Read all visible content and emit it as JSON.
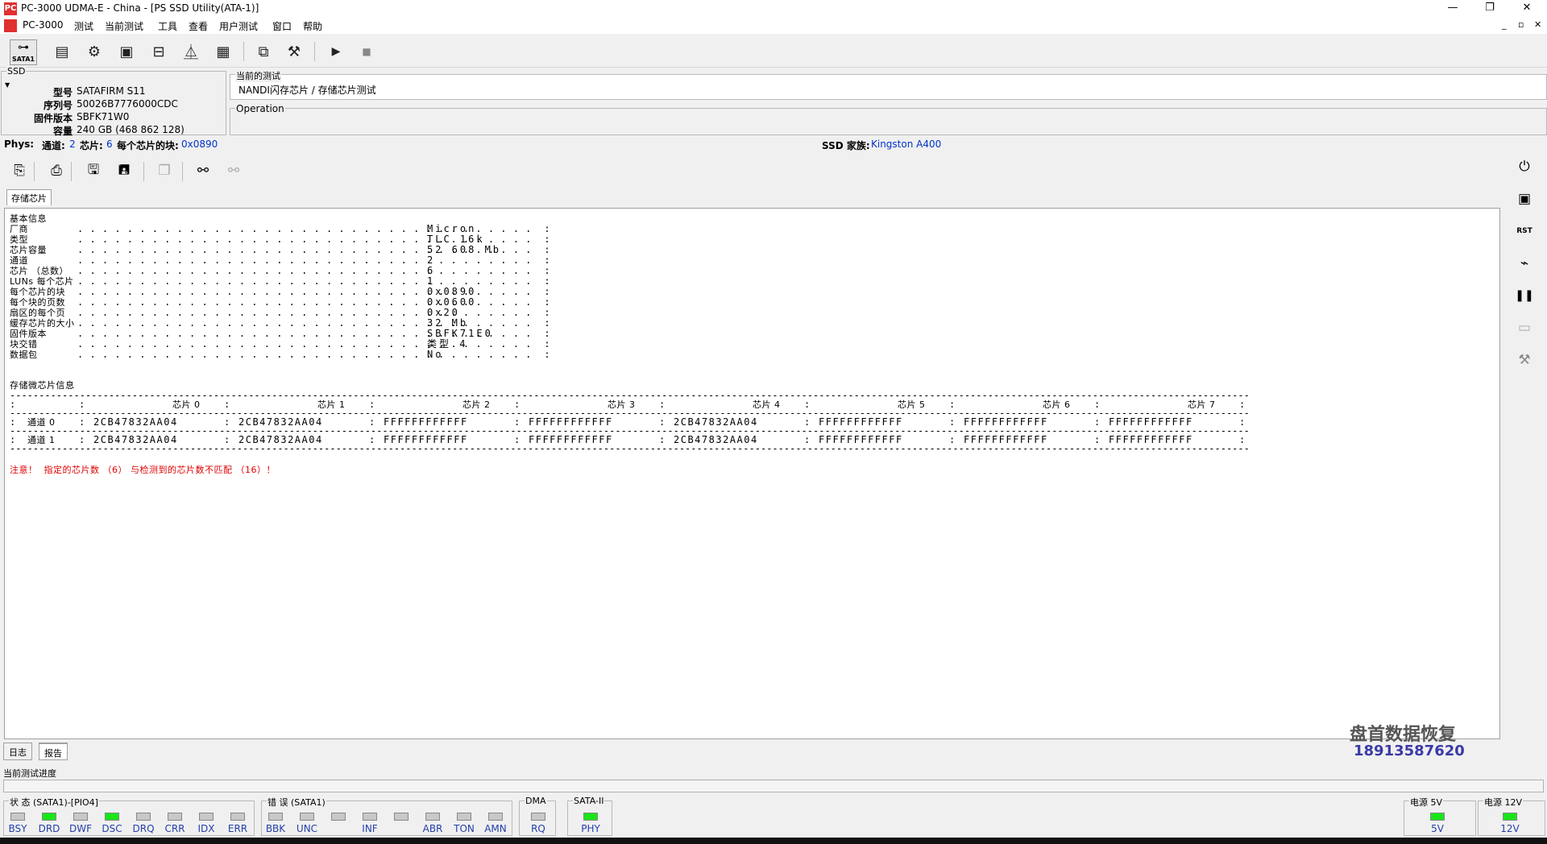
{
  "window": {
    "title": "PC-3000 UDMA-E - China - [PS SSD Utility(ATA-1)]",
    "app_icon": "PC"
  },
  "menu": [
    "PC-3000",
    "测试",
    "当前测试",
    "工具",
    "查看",
    "用户测试",
    "窗口",
    "帮助"
  ],
  "toolbar": {
    "sata_label": "SATA1"
  },
  "ssd": {
    "caption": "SSD",
    "model_label": "型号",
    "model": "SATAFIRM   S11",
    "serial_label": "序列号",
    "serial": "50026B7776000CDC",
    "firmware_label": "固件版本",
    "firmware": "SBFK71W0",
    "capacity_label": "容量",
    "capacity": "240 GB (468 862 128)"
  },
  "current_test": {
    "caption": "当前的测试",
    "value": "NANDI闪存芯片 / 存储芯片测试"
  },
  "operation": {
    "caption": "Operation"
  },
  "phys": {
    "label": "Phys:",
    "channels_label": "通道:",
    "channels": "2",
    "chips_label": "芯片:",
    "chips": "6",
    "blocks_label": "每个芯片的块:",
    "blocks": "0x0890",
    "family_label": "SSD 家族:",
    "family": "Kingston A400"
  },
  "tab": {
    "label": "存储芯片"
  },
  "report": {
    "basic_header": "基本信息",
    "basic": [
      {
        "label": "厂商",
        "value": "Micron"
      },
      {
        "label": "类型",
        "value": "TLC 16k"
      },
      {
        "label": "芯片容量",
        "value": "52 608 Mb"
      },
      {
        "label": "通道",
        "value": "2"
      },
      {
        "label": "芯片 （总数）",
        "value": "6"
      },
      {
        "label": "LUNs 每个芯片",
        "value": "1"
      },
      {
        "label": "每个芯片的块",
        "value": "0x0890"
      },
      {
        "label": "每个块的页数",
        "value": "0x0600"
      },
      {
        "label": "扇区的每个页",
        "value": "0x20"
      },
      {
        "label": "缓存芯片的大小",
        "value": "32 Mb"
      },
      {
        "label": "固件版本",
        "value": "SBFK71E0"
      },
      {
        "label": "块交错",
        "value": "类型 4"
      },
      {
        "label": "数据包",
        "value": "No"
      }
    ],
    "chip_header": "存储微芯片信息",
    "table_headers": [
      "芯片 0",
      "芯片 1",
      "芯片 2",
      "芯片 3",
      "芯片 4",
      "芯片 5",
      "芯片 6",
      "芯片 7"
    ],
    "rows": [
      {
        "label": "通道 0",
        "cells": [
          "2CB47832AA04",
          "2CB47832AA04",
          "FFFFFFFFFFFF",
          "FFFFFFFFFFFF",
          "2CB47832AA04",
          "FFFFFFFFFFFF",
          "FFFFFFFFFFFF",
          "FFFFFFFFFFFF"
        ]
      },
      {
        "label": "通道 1",
        "cells": [
          "2CB47832AA04",
          "2CB47832AA04",
          "FFFFFFFFFFFF",
          "FFFFFFFFFFFF",
          "2CB47832AA04",
          "FFFFFFFFFFFF",
          "FFFFFFFFFFFF",
          "FFFFFFFFFFFF"
        ]
      }
    ],
    "warning": "注意！  指定的芯片数 （6） 与检测到的芯片数不匹配 （16）！"
  },
  "bottom_tabs": [
    "日志",
    "报告"
  ],
  "watermark": {
    "name": "盘首数据恢复",
    "phone": "18913587620"
  },
  "progress": {
    "label": "当前测试进度"
  },
  "status": {
    "caption": "状 态 (SATA1)-[PIO4]",
    "leds": [
      {
        "label": "BSY",
        "on": false
      },
      {
        "label": "DRD",
        "on": true
      },
      {
        "label": "DWF",
        "on": false
      },
      {
        "label": "DSC",
        "on": true
      },
      {
        "label": "DRQ",
        "on": false
      },
      {
        "label": "CRR",
        "on": false
      },
      {
        "label": "IDX",
        "on": false
      },
      {
        "label": "ERR",
        "on": false
      }
    ]
  },
  "errors": {
    "caption": "错 误 (SATA1)",
    "leds": [
      {
        "label": "BBK",
        "on": false
      },
      {
        "label": "UNC",
        "on": false
      },
      {
        "label": "",
        "on": false
      },
      {
        "label": "INF",
        "on": false
      },
      {
        "label": "",
        "on": false
      },
      {
        "label": "ABR",
        "on": false
      },
      {
        "label": "TON",
        "on": false
      },
      {
        "label": "AMN",
        "on": false
      }
    ]
  },
  "dma": {
    "caption": "DMA",
    "led_label": "RQ",
    "on": false
  },
  "sata2": {
    "caption": "SATA-II",
    "led_label": "PHY",
    "on": true
  },
  "power5": {
    "caption": "电源 5V",
    "led_label": "5V",
    "on": true
  },
  "power12": {
    "caption": "电源 12V",
    "led_label": "12V",
    "on": true
  },
  "colors": {
    "led_on": "#19e619",
    "link_blue": "#0033cc",
    "warning_red": "#e00000"
  }
}
